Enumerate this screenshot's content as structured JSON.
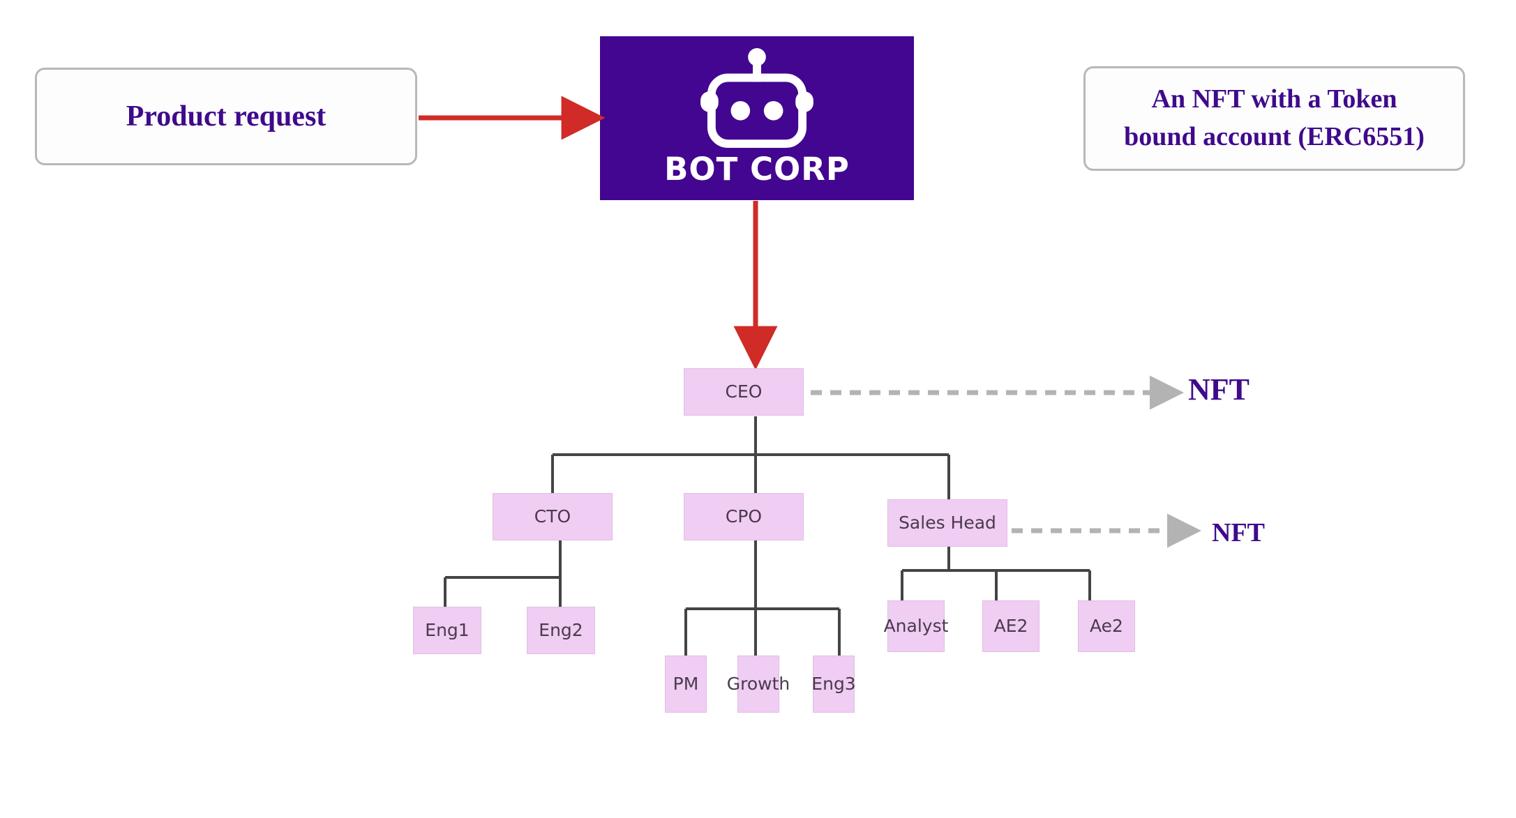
{
  "callouts": {
    "product_request": "Product request",
    "nft_definition_line1": "An NFT with a Token",
    "nft_definition_line2": "bound account (ERC6551)"
  },
  "brand": {
    "name": "BOT CORP",
    "logo_icon": "robot-head-icon",
    "background_color": "#430690",
    "foreground_color": "#ffffff"
  },
  "annotations": {
    "nft_ceo": "NFT",
    "nft_sales_head": "NFT"
  },
  "flow_arrows": [
    {
      "name": "product-request-to-brand",
      "style": "solid",
      "color": "#d02b27",
      "direction": "right"
    },
    {
      "name": "brand-to-ceo",
      "style": "solid",
      "color": "#d02b27",
      "direction": "down"
    },
    {
      "name": "ceo-to-nft",
      "style": "dashed",
      "color": "#b3b3b3",
      "direction": "right"
    },
    {
      "name": "sales-head-to-nft",
      "style": "dashed",
      "color": "#b3b3b3",
      "direction": "right"
    }
  ],
  "colors": {
    "node_fill": "#f0cdf2",
    "node_border": "#e0bde4",
    "node_text": "#4a3a4e",
    "connector": "#444444",
    "accent_purple": "#3f0a8c",
    "accent_red": "#d02b27",
    "dashed_gray": "#b3b3b3",
    "callout_border": "#b8b8b8"
  },
  "org_chart": {
    "root": "CEO",
    "nodes": [
      {
        "id": "ceo",
        "label": "CEO",
        "level": 0,
        "parent": null
      },
      {
        "id": "cto",
        "label": "CTO",
        "level": 1,
        "parent": "ceo"
      },
      {
        "id": "cpo",
        "label": "CPO",
        "level": 1,
        "parent": "ceo"
      },
      {
        "id": "sales",
        "label": "Sales Head",
        "level": 1,
        "parent": "ceo"
      },
      {
        "id": "eng1",
        "label": "Eng1",
        "level": 2,
        "parent": "cto"
      },
      {
        "id": "eng2",
        "label": "Eng2",
        "level": 2,
        "parent": "cto"
      },
      {
        "id": "pm",
        "label": "PM",
        "level": 2,
        "parent": "cpo"
      },
      {
        "id": "growth",
        "label": "Growth",
        "level": 2,
        "parent": "cpo"
      },
      {
        "id": "eng3",
        "label": "Eng3",
        "level": 2,
        "parent": "cpo"
      },
      {
        "id": "analyst",
        "label": "Analyst",
        "level": 2,
        "parent": "sales"
      },
      {
        "id": "ae2",
        "label": "AE2",
        "level": 2,
        "parent": "sales"
      },
      {
        "id": "ae2b",
        "label": "Ae2",
        "level": 2,
        "parent": "sales"
      }
    ]
  }
}
